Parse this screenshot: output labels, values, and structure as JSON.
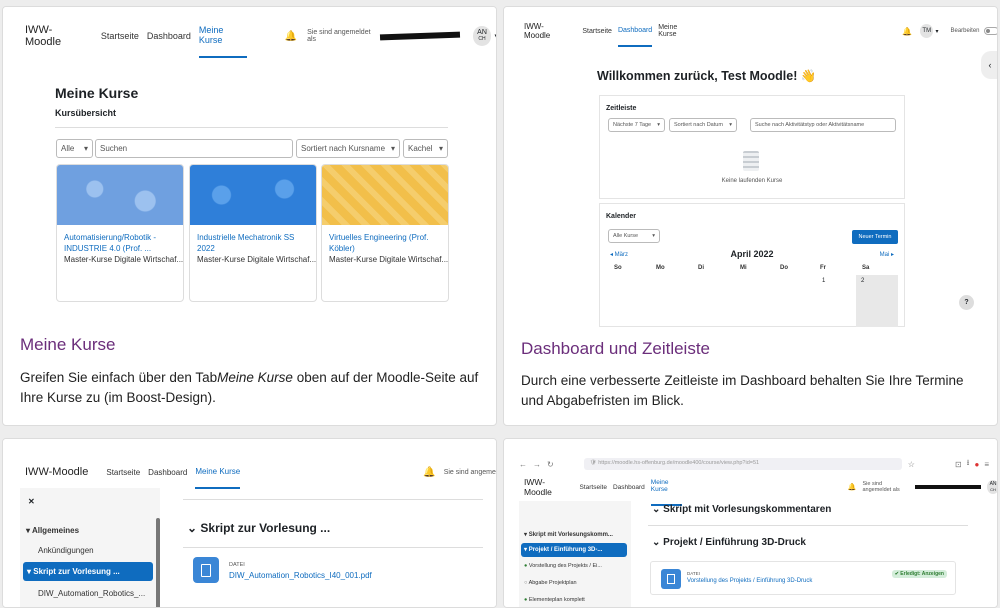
{
  "cards": [
    {
      "title": "Meine Kurse",
      "text_before": "Greifen Sie einfach über den Tab",
      "text_italic": "Meine Kurse",
      "text_after": " oben auf der Moodle-Seite auf Ihre Kurse zu (im Boost-Design).",
      "nav": {
        "brand": "IWW-Moodle",
        "links": [
          "Startseite",
          "Dashboard",
          "Meine Kurse"
        ],
        "logged_in": "Sie sind angemeldet als",
        "avatar": "AN",
        "avatar_sub": "CH"
      },
      "page_title": "Meine Kurse",
      "subtitle": "Kursübersicht",
      "filter_all": "Alle",
      "search_placeholder": "Suchen",
      "sort": "Sortiert nach Kursname",
      "view": "Kachel",
      "courses": [
        {
          "name": "Automatisierung/Robotik - INDUSTRIE 4.0 (Prof. ...",
          "category": "Master-Kurse Digitale Wirtschaf...",
          "color": "#6fa0e0"
        },
        {
          "name": "Industrielle Mechatronik SS 2022",
          "category": "Master-Kurse Digitale Wirtschaf...",
          "color": "#2f7fd9"
        },
        {
          "name": "Virtuelles Engineering (Prof. Köbler)",
          "category": "Master-Kurse Digitale Wirtschaf...",
          "color": "#f2bf4a"
        }
      ]
    },
    {
      "title": "Dashboard und Zeitleiste",
      "text": "Durch eine verbesserte Zeitleiste im Dashboard behalten Sie Ihre Termine und Abgabefristen im Blick.",
      "nav": {
        "brand": "IWW-Moodle",
        "links": [
          "Startseite",
          "Dashboard",
          "Meine Kurse"
        ],
        "avatar": "TM",
        "edit": "Bearbeiten"
      },
      "welcome": "Willkommen zurück, Test Moodle! 👋",
      "timeline_title": "Zeitleiste",
      "timeline_range": "Nächste 7 Tage",
      "timeline_sort": "Sortiert nach Datum",
      "timeline_search": "Suche nach Aktivitätstyp oder Aktivitätsname",
      "timeline_empty": "Keine laufenden Kurse",
      "calendar_title": "Kalender",
      "calendar_filter": "Alle Kurse",
      "new_event": "Neuer Termin",
      "prev_month": "◂ März",
      "month": "April 2022",
      "next_month": "Mai ▸",
      "weekdays": [
        "So",
        "Mo",
        "Di",
        "Mi",
        "Do",
        "Fr",
        "Sa"
      ],
      "days": [
        "1",
        "2"
      ],
      "help": "?"
    },
    {
      "nav": {
        "brand": "IWW-Moodle",
        "links": [
          "Startseite",
          "Dashboard",
          "Meine Kurse"
        ],
        "logged_in": "Sie sind angeme"
      },
      "close": "✕",
      "sidebar": [
        "Allgemeines",
        "Ankündigungen",
        "Skript zur Vorlesung ...",
        "DIW_Automation_Robotics_..."
      ],
      "section_title": "Skript zur Vorlesung ...",
      "file_label": "DATEI",
      "file_name": "DIW_Automation_Robotics_I40_001.pdf"
    },
    {
      "browser_url": "https://moodle.hs-offenburg.de/moodle400/course/view.php?id=51",
      "nav": {
        "brand": "IWW-Moodle",
        "links": [
          "Startseite",
          "Dashboard",
          "Meine Kurse"
        ],
        "logged_in": "Sie sind angemeldet als",
        "avatar": "AN",
        "avatar_sub": "CH"
      },
      "sidebar": [
        "Skript mit Vorlesungskomm...",
        "Projekt / Einführung 3D-...",
        "Vorstellung des Projekts / Ei...",
        "Abgabe Projektplan",
        "Elementeplan komplett"
      ],
      "section1": "Skript mit Vorlesungskommentaren",
      "section2": "Projekt / Einführung 3D-Druck",
      "file_label": "DATEI",
      "file_name": "Vorstellung des Projekts / Einführung 3D-Druck",
      "done_label": "✔ Erledigt: Anzeigen"
    }
  ],
  "colors": {
    "accent": "#0f6cbf",
    "title": "#6b2e7b"
  }
}
